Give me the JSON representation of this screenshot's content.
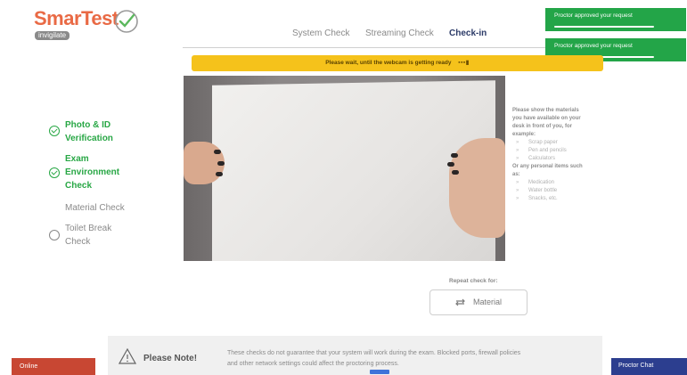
{
  "logo": {
    "text": "SmarTest",
    "sub": "invigilate"
  },
  "tabs": [
    {
      "label": "System Check",
      "active": false
    },
    {
      "label": "Streaming Check",
      "active": false
    },
    {
      "label": "Check-in",
      "active": true
    }
  ],
  "toasts": [
    {
      "text": "Proctor approved your request"
    },
    {
      "text": "Proctor approved your request"
    }
  ],
  "banner": {
    "text": "Please wait, until the webcam is getting ready"
  },
  "steps": [
    {
      "label_1": "Photo & ID",
      "label_2": "Verification",
      "status": "done"
    },
    {
      "label_1": "Exam",
      "label_2": "Environment",
      "label_3": "Check",
      "status": "done"
    },
    {
      "label_1": "Material Check",
      "status": "current"
    },
    {
      "label_1": "Toilet Break",
      "label_2": "Check",
      "status": "pending"
    }
  ],
  "instructions": {
    "intro": [
      "Please show the materials",
      "you have available on your",
      "desk in front of you, for",
      "example:"
    ],
    "items_a": [
      "Scrap paper",
      "Pen and pencils",
      "Calculators"
    ],
    "middle": [
      "Or any personal items such",
      "as:"
    ],
    "items_b": [
      "Medication",
      "Water bottle",
      "Snacks, etc."
    ]
  },
  "repeat": {
    "label": "Repeat check for:",
    "button": "Material"
  },
  "note": {
    "title": "Please Note!",
    "line1": "These checks do not guarantee that your system will work during the exam. Blocked ports, firewall policies",
    "line2": "and other network settings could affect the proctoring process."
  },
  "status": {
    "online": "Online"
  },
  "chat": {
    "label": "Proctor Chat"
  },
  "colors": {
    "accent_green": "#28a745",
    "toast": "#23a548",
    "banner": "#f5c21b",
    "online": "#c84733",
    "chat": "#2c3e8f",
    "active_tab": "#2b3a67"
  }
}
